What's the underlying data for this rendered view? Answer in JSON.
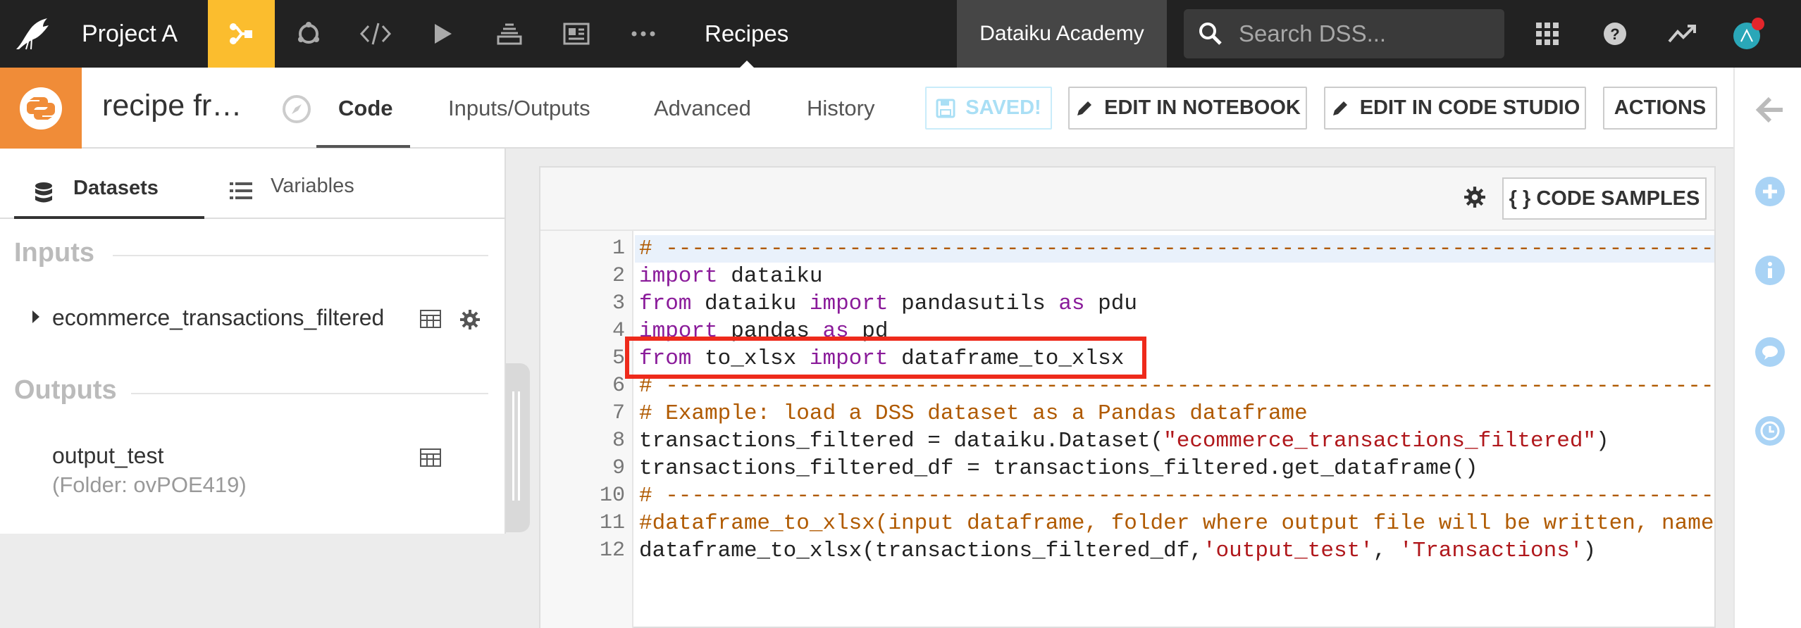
{
  "topbar": {
    "project_name": "Project A",
    "current_section": "Recipes",
    "academy_label": "Dataiku Academy",
    "search_placeholder": "Search DSS..."
  },
  "recipe": {
    "title": "recipe fr…",
    "tabs": [
      "Code",
      "Inputs/Outputs",
      "Advanced",
      "History"
    ],
    "buttons": {
      "saved": "SAVED!",
      "edit_notebook": "EDIT IN NOTEBOOK",
      "edit_code_studio": "EDIT IN CODE STUDIO",
      "actions": "ACTIONS"
    }
  },
  "left_panel": {
    "tabs": [
      "Datasets",
      "Variables"
    ],
    "inputs_title": "Inputs",
    "input_dataset": "ecommerce_transactions_filtered",
    "outputs_title": "Outputs",
    "output_name": "output_test",
    "output_sub": "(Folder: ovPOE419)"
  },
  "code": {
    "code_samples_label": "{ } CODE SAMPLES",
    "line_numbers": [
      "1",
      "2",
      "3",
      "4",
      "5",
      "6",
      "7",
      "8",
      "9",
      "10",
      "11",
      "12"
    ],
    "lines": [
      [
        {
          "t": "# -------------------------------------------------------------------------------------------",
          "c": "cm"
        }
      ],
      [
        {
          "t": "import",
          "c": "kw"
        },
        {
          "t": " dataiku",
          "c": ""
        }
      ],
      [
        {
          "t": "from",
          "c": "kw"
        },
        {
          "t": " dataiku ",
          "c": ""
        },
        {
          "t": "import",
          "c": "kw"
        },
        {
          "t": " pandasutils ",
          "c": ""
        },
        {
          "t": "as",
          "c": "kw"
        },
        {
          "t": " pdu",
          "c": ""
        }
      ],
      [
        {
          "t": "import",
          "c": "kw"
        },
        {
          "t": " pandas ",
          "c": ""
        },
        {
          "t": "as",
          "c": "kw"
        },
        {
          "t": " pd",
          "c": ""
        }
      ],
      [
        {
          "t": "from",
          "c": "kw"
        },
        {
          "t": " to_xlsx ",
          "c": ""
        },
        {
          "t": "import",
          "c": "kw"
        },
        {
          "t": " dataframe_to_xlsx",
          "c": ""
        }
      ],
      [
        {
          "t": "# -------------------------------------------------------------------------------------------",
          "c": "cm"
        }
      ],
      [
        {
          "t": "# Example: load a DSS dataset as a Pandas dataframe",
          "c": "cm"
        }
      ],
      [
        {
          "t": "transactions_filtered = dataiku.Dataset(",
          "c": ""
        },
        {
          "t": "\"ecommerce_transactions_filtered\"",
          "c": "str"
        },
        {
          "t": ")",
          "c": ""
        }
      ],
      [
        {
          "t": "transactions_filtered_df = transactions_filtered.get_dataframe()",
          "c": ""
        }
      ],
      [
        {
          "t": "# -------------------------------------------------------------------------------------------",
          "c": "cm"
        }
      ],
      [
        {
          "t": "#dataframe_to_xlsx(input dataframe, folder where output file will be written, name",
          "c": "cm"
        }
      ],
      [
        {
          "t": "dataframe_to_xlsx(transactions_filtered_df,",
          "c": ""
        },
        {
          "t": "'output_test'",
          "c": "str"
        },
        {
          "t": ", ",
          "c": ""
        },
        {
          "t": "'Transactions'",
          "c": "str"
        },
        {
          "t": ")",
          "c": ""
        }
      ]
    ]
  },
  "colors": {
    "topbar_bg": "#222222",
    "flow_active": "#fbbd2e",
    "python_recipe": "#f08c38",
    "highlight": "#ee2a1b",
    "rail_accent": "#a9d3f5"
  }
}
